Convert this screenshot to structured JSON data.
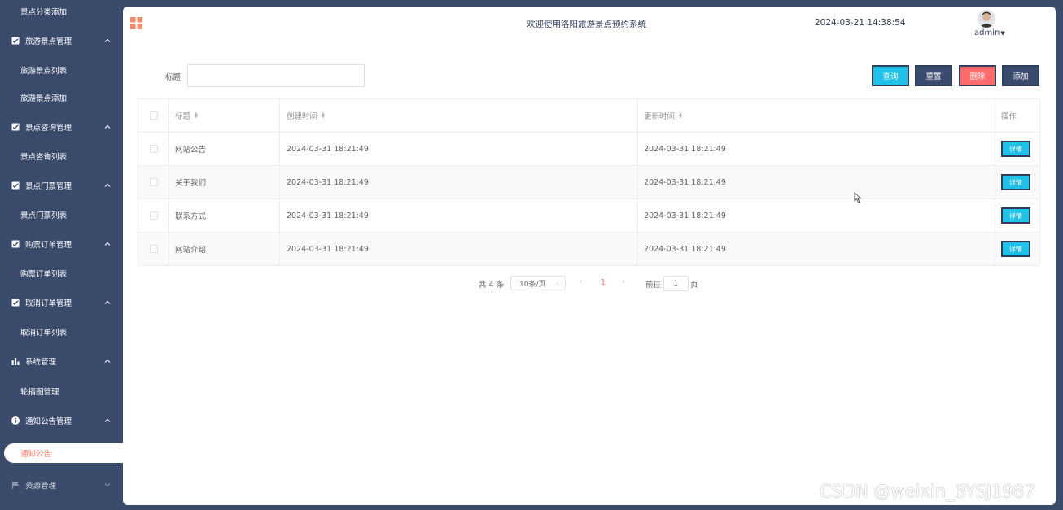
{
  "sidebar": {
    "items": [
      {
        "label": "景点分类添加",
        "kind": "sub"
      },
      {
        "label": "旅游景点管理",
        "kind": "group",
        "icon": "checkbox-icon"
      },
      {
        "label": "旅游景点列表",
        "kind": "sub"
      },
      {
        "label": "旅游景点添加",
        "kind": "sub"
      },
      {
        "label": "景点咨询管理",
        "kind": "group",
        "icon": "checkbox-icon"
      },
      {
        "label": "景点咨询列表",
        "kind": "sub"
      },
      {
        "label": "景点门票管理",
        "kind": "group",
        "icon": "checkbox-icon"
      },
      {
        "label": "景点门票列表",
        "kind": "sub"
      },
      {
        "label": "购票订单管理",
        "kind": "group",
        "icon": "checkbox-icon"
      },
      {
        "label": "购票订单列表",
        "kind": "sub"
      },
      {
        "label": "取消订单管理",
        "kind": "group",
        "icon": "checkbox-icon"
      },
      {
        "label": "取消订单列表",
        "kind": "sub"
      },
      {
        "label": "系统管理",
        "kind": "group",
        "icon": "bar-chart-icon"
      },
      {
        "label": "轮播图管理",
        "kind": "sub"
      },
      {
        "label": "通知公告管理",
        "kind": "group",
        "icon": "info-icon"
      },
      {
        "label": "通知公告",
        "kind": "active"
      },
      {
        "label": "资源管理",
        "kind": "group",
        "icon": "flag-icon"
      }
    ]
  },
  "header": {
    "title": "欢迎使用洛阳旅游景点预约系统",
    "datetime": "2024-03-21 14:38:54",
    "username": "admin"
  },
  "search": {
    "label": "标题",
    "value": "",
    "placeholder": ""
  },
  "toolbar": {
    "search_label": "查询",
    "reset_label": "重置",
    "delete_label": "删除",
    "add_label": "添加"
  },
  "table": {
    "headers": {
      "title": "标题",
      "created": "创建时间",
      "updated": "更新时间",
      "ops": "操作"
    },
    "rows": [
      {
        "title": "网站公告",
        "created": "2024-03-31 18:21:49",
        "updated": "2024-03-31 18:21:49",
        "action": "详情"
      },
      {
        "title": "关于我们",
        "created": "2024-03-31 18:21:49",
        "updated": "2024-03-31 18:21:49",
        "action": "详情"
      },
      {
        "title": "联系方式",
        "created": "2024-03-31 18:21:49",
        "updated": "2024-03-31 18:21:49",
        "action": "详情"
      },
      {
        "title": "网站介绍",
        "created": "2024-03-31 18:21:49",
        "updated": "2024-03-31 18:21:49",
        "action": "详情"
      }
    ]
  },
  "pagination": {
    "total": "共 4 条",
    "page_size": "10条/页",
    "current": "1",
    "goto_label": "前往",
    "goto_value": "1",
    "page_suffix": "页"
  },
  "watermark": "CSDN @weixin_BYSJ1987",
  "colors": {
    "sidebar_bg": "#3a4a6b",
    "accent_cyan": "#1fc1e8",
    "accent_red": "#ff6b6b",
    "active_text": "#ff7a62"
  }
}
